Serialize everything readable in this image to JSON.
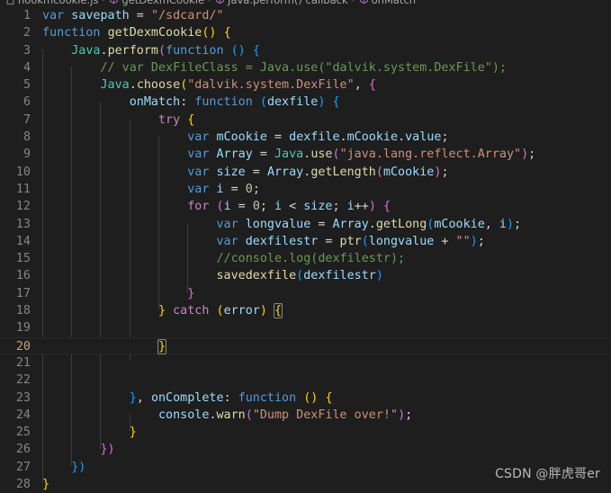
{
  "editor": {
    "theme_bg": "#1e1e1e",
    "line_number_color": "#858585",
    "active_line_number_color": "#c6a16b",
    "active_line": 20,
    "total_visible_lines": 28
  },
  "breadcrumb": {
    "separator": "›",
    "items": [
      {
        "label": "hookmcookie.js",
        "icon": "javascript-file-icon"
      },
      {
        "label": "getDexmCookie",
        "icon": "symbol-method-icon"
      },
      {
        "label": "Java.perform() callback",
        "icon": "symbol-method-icon"
      },
      {
        "label": "onMatch",
        "icon": "symbol-method-icon"
      }
    ]
  },
  "code": {
    "language": "javascript",
    "lines": [
      {
        "n": 1,
        "tokens": [
          [
            "kw",
            "var"
          ],
          [
            "pun",
            " "
          ],
          [
            "id",
            "savepath"
          ],
          [
            "pun",
            " = "
          ],
          [
            "str",
            "\"/sdcard/\""
          ]
        ]
      },
      {
        "n": 2,
        "tokens": [
          [
            "kw",
            "function"
          ],
          [
            "pun",
            " "
          ],
          [
            "fn",
            "getDexmCookie"
          ],
          [
            "br1",
            "()"
          ],
          [
            "pun",
            " "
          ],
          [
            "br1",
            "{"
          ]
        ]
      },
      {
        "n": 3,
        "tokens": [
          [
            "pun",
            "    "
          ],
          [
            "cls",
            "Java"
          ],
          [
            "pun",
            "."
          ],
          [
            "fn",
            "perform"
          ],
          [
            "br2",
            "("
          ],
          [
            "kw",
            "function"
          ],
          [
            "pun",
            " "
          ],
          [
            "br3",
            "()"
          ],
          [
            "pun",
            " "
          ],
          [
            "br3",
            "{"
          ]
        ]
      },
      {
        "n": 4,
        "tokens": [
          [
            "pun",
            "        "
          ],
          [
            "cmt",
            "// var DexFileClass = Java.use(\"dalvik.system.DexFile\");"
          ]
        ]
      },
      {
        "n": 5,
        "tokens": [
          [
            "pun",
            "        "
          ],
          [
            "cls",
            "Java"
          ],
          [
            "pun",
            "."
          ],
          [
            "fn",
            "choose"
          ],
          [
            "br1",
            "("
          ],
          [
            "str",
            "\"dalvik.system.DexFile\""
          ],
          [
            "pun",
            ", "
          ],
          [
            "br2",
            "{"
          ]
        ]
      },
      {
        "n": 6,
        "tokens": [
          [
            "pun",
            "            "
          ],
          [
            "id",
            "onMatch"
          ],
          [
            "pun",
            ": "
          ],
          [
            "kw",
            "function"
          ],
          [
            "pun",
            " "
          ],
          [
            "br3",
            "("
          ],
          [
            "id",
            "dexfile"
          ],
          [
            "br3",
            ")"
          ],
          [
            "pun",
            " "
          ],
          [
            "br3",
            "{"
          ]
        ]
      },
      {
        "n": 7,
        "tokens": [
          [
            "pun",
            "                "
          ],
          [
            "ctl",
            "try"
          ],
          [
            "pun",
            " "
          ],
          [
            "br1",
            "{"
          ]
        ]
      },
      {
        "n": 8,
        "tokens": [
          [
            "pun",
            "                    "
          ],
          [
            "kw",
            "var"
          ],
          [
            "pun",
            " "
          ],
          [
            "id",
            "mCookie"
          ],
          [
            "pun",
            " = "
          ],
          [
            "id",
            "dexfile"
          ],
          [
            "pun",
            "."
          ],
          [
            "id",
            "mCookie"
          ],
          [
            "pun",
            "."
          ],
          [
            "id",
            "value"
          ],
          [
            "pun",
            ";"
          ]
        ]
      },
      {
        "n": 9,
        "tokens": [
          [
            "pun",
            "                    "
          ],
          [
            "kw",
            "var"
          ],
          [
            "pun",
            " "
          ],
          [
            "id",
            "Array"
          ],
          [
            "pun",
            " = "
          ],
          [
            "cls",
            "Java"
          ],
          [
            "pun",
            "."
          ],
          [
            "fn",
            "use"
          ],
          [
            "br2",
            "("
          ],
          [
            "str",
            "\"java.lang.reflect.Array\""
          ],
          [
            "br2",
            ")"
          ],
          [
            "pun",
            ";"
          ]
        ]
      },
      {
        "n": 10,
        "tokens": [
          [
            "pun",
            "                    "
          ],
          [
            "kw",
            "var"
          ],
          [
            "pun",
            " "
          ],
          [
            "id",
            "size"
          ],
          [
            "pun",
            " = "
          ],
          [
            "id",
            "Array"
          ],
          [
            "pun",
            "."
          ],
          [
            "fn",
            "getLength"
          ],
          [
            "br2",
            "("
          ],
          [
            "id",
            "mCookie"
          ],
          [
            "br2",
            ")"
          ],
          [
            "pun",
            ";"
          ]
        ]
      },
      {
        "n": 11,
        "tokens": [
          [
            "pun",
            "                    "
          ],
          [
            "kw",
            "var"
          ],
          [
            "pun",
            " "
          ],
          [
            "id",
            "i"
          ],
          [
            "pun",
            " = "
          ],
          [
            "num",
            "0"
          ],
          [
            "pun",
            ";"
          ]
        ]
      },
      {
        "n": 12,
        "tokens": [
          [
            "pun",
            "                    "
          ],
          [
            "ctl",
            "for"
          ],
          [
            "pun",
            " "
          ],
          [
            "br2",
            "("
          ],
          [
            "id",
            "i"
          ],
          [
            "pun",
            " = "
          ],
          [
            "num",
            "0"
          ],
          [
            "pun",
            "; "
          ],
          [
            "id",
            "i"
          ],
          [
            "pun",
            " < "
          ],
          [
            "id",
            "size"
          ],
          [
            "pun",
            "; "
          ],
          [
            "id",
            "i"
          ],
          [
            "pun",
            "++"
          ],
          [
            "br2",
            ")"
          ],
          [
            "pun",
            " "
          ],
          [
            "br2",
            "{"
          ]
        ]
      },
      {
        "n": 13,
        "tokens": [
          [
            "pun",
            "                        "
          ],
          [
            "kw",
            "var"
          ],
          [
            "pun",
            " "
          ],
          [
            "id",
            "longvalue"
          ],
          [
            "pun",
            " = "
          ],
          [
            "id",
            "Array"
          ],
          [
            "pun",
            "."
          ],
          [
            "fn",
            "getLong"
          ],
          [
            "br3",
            "("
          ],
          [
            "id",
            "mCookie"
          ],
          [
            "pun",
            ", "
          ],
          [
            "id",
            "i"
          ],
          [
            "br3",
            ")"
          ],
          [
            "pun",
            ";"
          ]
        ]
      },
      {
        "n": 14,
        "tokens": [
          [
            "pun",
            "                        "
          ],
          [
            "kw",
            "var"
          ],
          [
            "pun",
            " "
          ],
          [
            "id",
            "dexfilestr"
          ],
          [
            "pun",
            " = "
          ],
          [
            "fn",
            "ptr"
          ],
          [
            "br3",
            "("
          ],
          [
            "id",
            "longvalue"
          ],
          [
            "pun",
            " + "
          ],
          [
            "str",
            "\"\""
          ],
          [
            "br3",
            ")"
          ],
          [
            "pun",
            ";"
          ]
        ]
      },
      {
        "n": 15,
        "tokens": [
          [
            "pun",
            "                        "
          ],
          [
            "cmt",
            "//console.log(dexfilestr);"
          ]
        ]
      },
      {
        "n": 16,
        "tokens": [
          [
            "pun",
            "                        "
          ],
          [
            "fn",
            "savedexfile"
          ],
          [
            "br3",
            "("
          ],
          [
            "id",
            "dexfilestr"
          ],
          [
            "br3",
            ")"
          ]
        ]
      },
      {
        "n": 17,
        "tokens": [
          [
            "pun",
            "                    "
          ],
          [
            "br2",
            "}"
          ]
        ]
      },
      {
        "n": 18,
        "tokens": [
          [
            "pun",
            "                "
          ],
          [
            "br1",
            "}"
          ],
          [
            "pun",
            " "
          ],
          [
            "ctl",
            "catch"
          ],
          [
            "pun",
            " "
          ],
          [
            "br1",
            "("
          ],
          [
            "id",
            "error"
          ],
          [
            "br1",
            ")"
          ],
          [
            "pun",
            " "
          ],
          [
            "br1",
            "{",
            "match"
          ]
        ]
      },
      {
        "n": 19,
        "tokens": []
      },
      {
        "n": 20,
        "tokens": [
          [
            "pun",
            "                "
          ],
          [
            "br1",
            "}",
            "match"
          ]
        ]
      },
      {
        "n": 21,
        "tokens": []
      },
      {
        "n": 22,
        "tokens": []
      },
      {
        "n": 23,
        "tokens": [
          [
            "pun",
            "            "
          ],
          [
            "br3",
            "}"
          ],
          [
            "pun",
            ", "
          ],
          [
            "id",
            "onComplete"
          ],
          [
            "pun",
            ": "
          ],
          [
            "kw",
            "function"
          ],
          [
            "pun",
            " "
          ],
          [
            "br1",
            "()"
          ],
          [
            "pun",
            " "
          ],
          [
            "br1",
            "{"
          ]
        ]
      },
      {
        "n": 24,
        "tokens": [
          [
            "pun",
            "                "
          ],
          [
            "id",
            "console"
          ],
          [
            "pun",
            "."
          ],
          [
            "fn",
            "warn"
          ],
          [
            "br2",
            "("
          ],
          [
            "str",
            "\"Dump DexFile over!\""
          ],
          [
            "br2",
            ")"
          ],
          [
            "pun",
            ";"
          ]
        ]
      },
      {
        "n": 25,
        "tokens": [
          [
            "pun",
            "            "
          ],
          [
            "br1",
            "}"
          ]
        ]
      },
      {
        "n": 26,
        "tokens": [
          [
            "pun",
            "        "
          ],
          [
            "br2",
            "})"
          ]
        ]
      },
      {
        "n": 27,
        "tokens": [
          [
            "pun",
            "    "
          ],
          [
            "br3",
            "})"
          ]
        ]
      },
      {
        "n": 28,
        "tokens": [
          [
            "br1",
            "}"
          ]
        ]
      }
    ]
  },
  "watermark": {
    "text": "CSDN @胖虎哥er"
  }
}
